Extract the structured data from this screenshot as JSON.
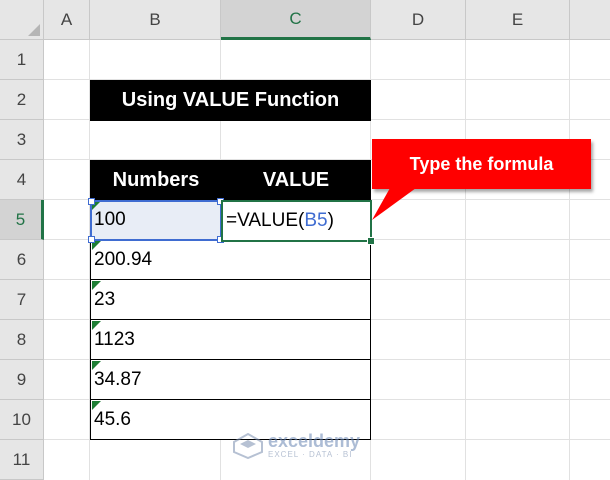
{
  "columns": [
    "A",
    "B",
    "C",
    "D",
    "E"
  ],
  "rows": [
    "1",
    "2",
    "3",
    "4",
    "5",
    "6",
    "7",
    "8",
    "9",
    "10",
    "11"
  ],
  "title": "Using VALUE Function",
  "table": {
    "headers": [
      "Numbers",
      "VALUE"
    ],
    "numbers": [
      "100",
      "200.94",
      "23",
      "1123",
      "34.87",
      "45.6"
    ]
  },
  "active_cell": {
    "formula_prefix": "=VALUE(",
    "formula_ref": "B5",
    "formula_suffix": ")"
  },
  "callout": {
    "text": "Type the formula"
  },
  "watermark": {
    "name": "exceldemy",
    "tagline": "EXCEL · DATA · BI"
  },
  "colors": {
    "header_bg": "#000000",
    "callout": "#ff0000",
    "selection": "#217346",
    "reference": "#3f6cd1",
    "error_flag": "#1e7e34"
  }
}
